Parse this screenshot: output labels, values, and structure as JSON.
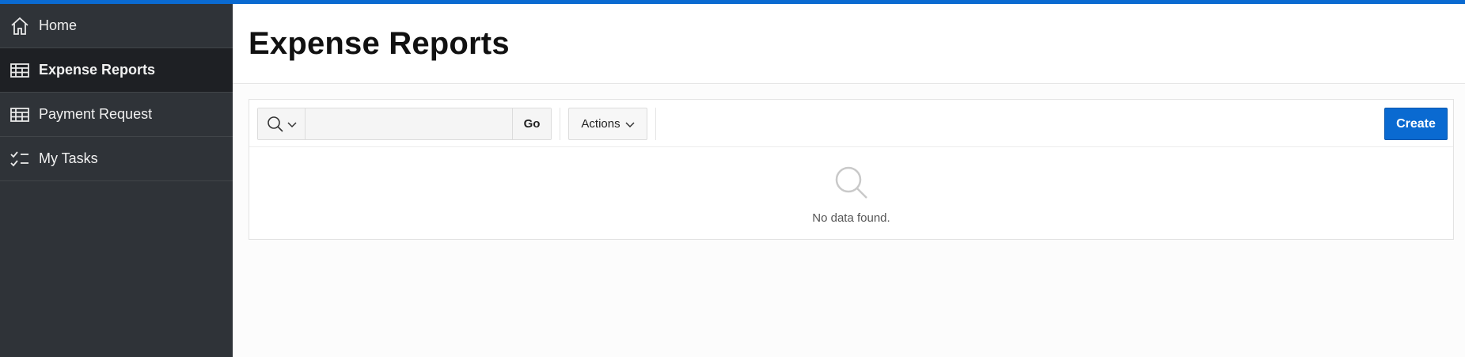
{
  "app": {
    "accent_color": "#0a6ad1",
    "sidebar_color": "#2f3338"
  },
  "sidebar": {
    "items": [
      {
        "label": "Home",
        "icon": "home-icon",
        "active": false
      },
      {
        "label": "Expense Reports",
        "icon": "table-icon",
        "active": true
      },
      {
        "label": "Payment Request",
        "icon": "table-icon",
        "active": false
      },
      {
        "label": "My Tasks",
        "icon": "checklist-icon",
        "active": false
      }
    ]
  },
  "page": {
    "title": "Expense Reports"
  },
  "toolbar": {
    "search_icon": "search-icon",
    "search_value": "",
    "search_placeholder": "",
    "go_label": "Go",
    "actions_label": "Actions",
    "create_label": "Create"
  },
  "report": {
    "empty_icon": "search-icon",
    "empty_message": "No data found."
  }
}
